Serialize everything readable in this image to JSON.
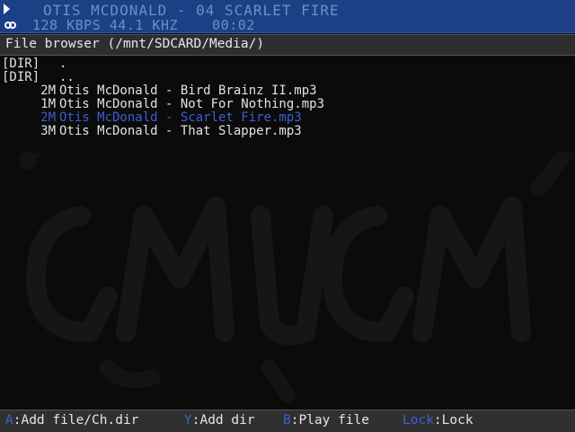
{
  "player": {
    "title": "OTIS MCDONALD - 04 SCARLET FIRE",
    "info": "128 KBPS 44.1 KHZ    00:02",
    "play_icon": "play-icon",
    "repeat_icon": "repeat-icon"
  },
  "browser": {
    "title": "File browser (/mnt/SDCARD/Media/)"
  },
  "files": [
    {
      "type": "[DIR]",
      "size": "",
      "name": "."
    },
    {
      "type": "[DIR]",
      "size": "",
      "name": ".."
    },
    {
      "type": "",
      "size": "2M",
      "name": "Otis McDonald - Bird Brainz II.mp3"
    },
    {
      "type": "",
      "size": "1M",
      "name": "Otis McDonald - Not For Nothing.mp3"
    },
    {
      "type": "",
      "size": "2M",
      "name": "Otis McDonald - Scarlet Fire.mp3"
    },
    {
      "type": "",
      "size": "3M",
      "name": "Otis McDonald - That Slapper.mp3"
    }
  ],
  "hints": {
    "a_key": "A",
    "a_label": ":Add file/Ch.dir",
    "y_key": "Y",
    "y_label": ":Add dir",
    "b_key": "B",
    "b_label": ":Play file",
    "lock_key": "Lock",
    "lock_label": ":Lock"
  },
  "colors": {
    "topbar": "#1d3f86",
    "accent": "#3d5fd6",
    "background": "#0b0b0b"
  }
}
